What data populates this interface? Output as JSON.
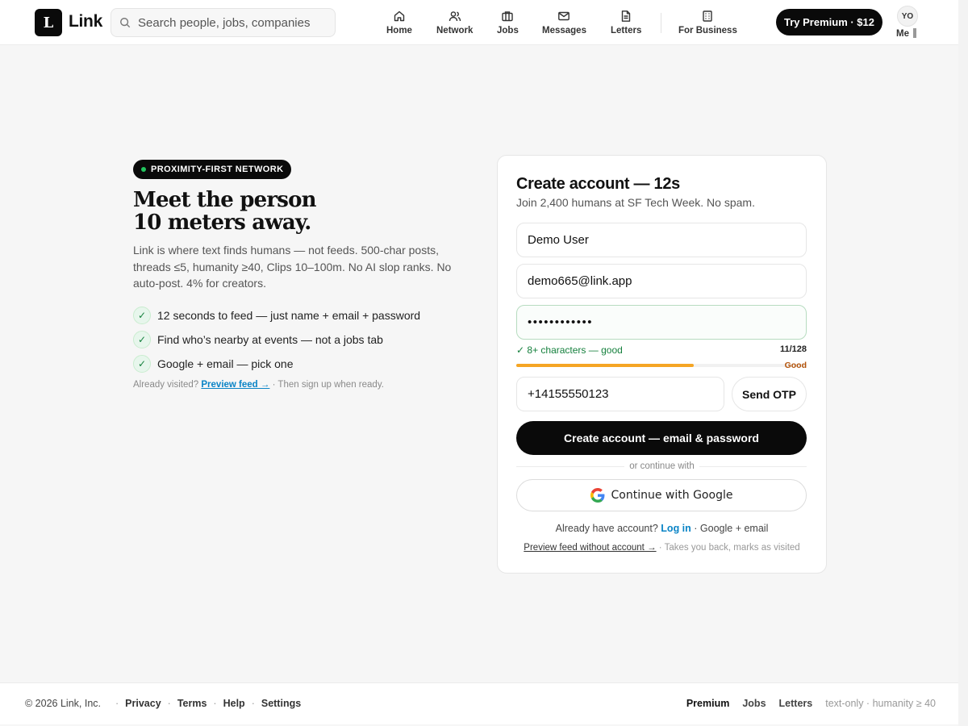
{
  "header": {
    "logo_letter": "L",
    "brand": "Link",
    "search_placeholder": "Search people, jobs, companies",
    "nav": [
      {
        "label": "Home",
        "icon": "home-icon"
      },
      {
        "label": "Network",
        "icon": "network-icon"
      },
      {
        "label": "Jobs",
        "icon": "briefcase-icon"
      },
      {
        "label": "Messages",
        "icon": "mail-icon"
      },
      {
        "label": "Letters",
        "icon": "document-icon"
      },
      {
        "label": "For Business",
        "icon": "building-icon"
      }
    ],
    "premium_label": "Try Premium · $12",
    "avatar_initials": "YO",
    "me_label": "Me"
  },
  "hero": {
    "badge": "PROXIMITY-FIRST NETWORK",
    "title_line1": "Meet the person",
    "title_line2": "10 meters away.",
    "description": "Link is where text finds humans — not feeds. 500-char posts, threads ≤5, humanity ≥40, Clips 10–100m. No AI slop ranks. No auto-post. 4% for creators.",
    "checks": [
      "12 seconds to feed — just name + email + password",
      "Find who’s nearby at events — not a jobs tab",
      "Google + email — pick one"
    ],
    "check_glyph": "✓",
    "visited_prefix": "Already visited?",
    "visited_link": "Preview feed →",
    "visited_suffix": "· Then sign up when ready."
  },
  "signup": {
    "title": "Create account — 12s",
    "subtitle": "Join 2,400 humans at SF Tech Week. No spam.",
    "name_value": "Demo User",
    "email_value": "demo665@link.app",
    "password_value": "••••••••••••",
    "password_hint": "✓ 8+ characters — good",
    "password_count": "11/128",
    "strength_percent": 61,
    "strength_label": "Good",
    "phone_value": "+14155550123",
    "otp_label": "Send OTP",
    "create_label": "Create account — email & password",
    "divider_label": "or continue with",
    "google_label": "Continue with Google",
    "login_prefix": "Already have account?",
    "login_link": "Log in",
    "login_suffix": "· Google + email",
    "preview_link": "Preview feed without account →",
    "preview_suffix": "· Takes you back, marks as visited"
  },
  "footer": {
    "copyright": "© 2026 Link, Inc.",
    "links": [
      "Privacy",
      "Terms",
      "Help",
      "Settings"
    ],
    "separator": "·",
    "right_premium": "Premium",
    "right_links": [
      "Jobs",
      "Letters"
    ],
    "meta": "text-only · humanity ≥ 40"
  },
  "colors": {
    "accent_link": "#0a84c6",
    "success": "#15803d",
    "strength": "#f5a524",
    "primary": "#0a0a0a"
  }
}
